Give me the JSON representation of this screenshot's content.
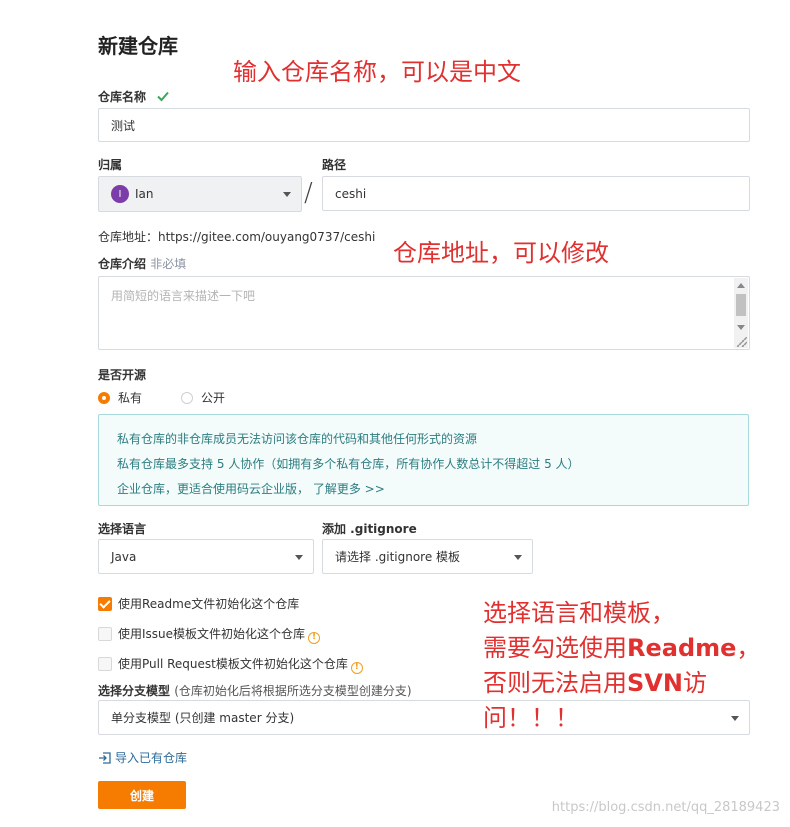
{
  "page": {
    "title": "新建仓库"
  },
  "repo_name": {
    "label": "仓库名称",
    "value": "测试"
  },
  "owner": {
    "label": "归属",
    "avatar_letter": "I",
    "value": "Ian"
  },
  "path": {
    "label": "路径",
    "separator": "/",
    "value": "ceshi"
  },
  "repo_address": {
    "text": "仓库地址：https://gitee.com/ouyang0737/ceshi"
  },
  "intro": {
    "label": "仓库介绍",
    "optional": "非必填",
    "placeholder": "用简短的语言来描述一下吧"
  },
  "visibility": {
    "label": "是否开源",
    "options": [
      {
        "label": "私有",
        "selected": true
      },
      {
        "label": "公开",
        "selected": false
      }
    ]
  },
  "info_box": {
    "line1": "私有仓库的非仓库成员无法访问该仓库的代码和其他任何形式的资源",
    "line2": "私有仓库最多支持 5 人协作（如拥有多个私有仓库，所有协作人数总计不得超过 5 人）",
    "line3_prefix": "企业仓库，更适合使用码云企业版，",
    "line3_link": "了解更多 >>"
  },
  "language": {
    "label": "选择语言",
    "value": "Java"
  },
  "gitignore": {
    "label": "添加 .gitignore",
    "value": "请选择 .gitignore 模板"
  },
  "init_options": [
    {
      "label": "使用Readme文件初始化这个仓库",
      "checked": true
    },
    {
      "label": "使用Issue模板文件初始化这个仓库",
      "checked": false
    },
    {
      "label": "使用Pull Request模板文件初始化这个仓库",
      "checked": false
    }
  ],
  "branch_model": {
    "label": "选择分支模型",
    "hint": "(仓库初始化后将根据所选分支模型创建分支)",
    "value": "单分支模型 (只创建 master 分支)"
  },
  "import": {
    "label": "导入已有仓库"
  },
  "create_button": {
    "label": "创建"
  },
  "annotations": {
    "name_note": "输入仓库名称，可以是中文",
    "address_note": "仓库地址，可以修改",
    "template_line1": "选择语言和模板，",
    "template_line2_prefix": "需要勾选使用",
    "template_line2_bold": "Readme",
    "template_line2_suffix": "，",
    "template_line3_prefix": "否则无法启用",
    "template_line3_bold": "SVN",
    "template_line3_suffix": "访",
    "template_line4": "问！！！"
  },
  "watermark": "https://blog.csdn.net/qq_28189423",
  "colors": {
    "accent": "#f57c00",
    "check_green": "#3aa757",
    "annotation_red": "#e03030",
    "info_teal": "#2d7d80"
  }
}
